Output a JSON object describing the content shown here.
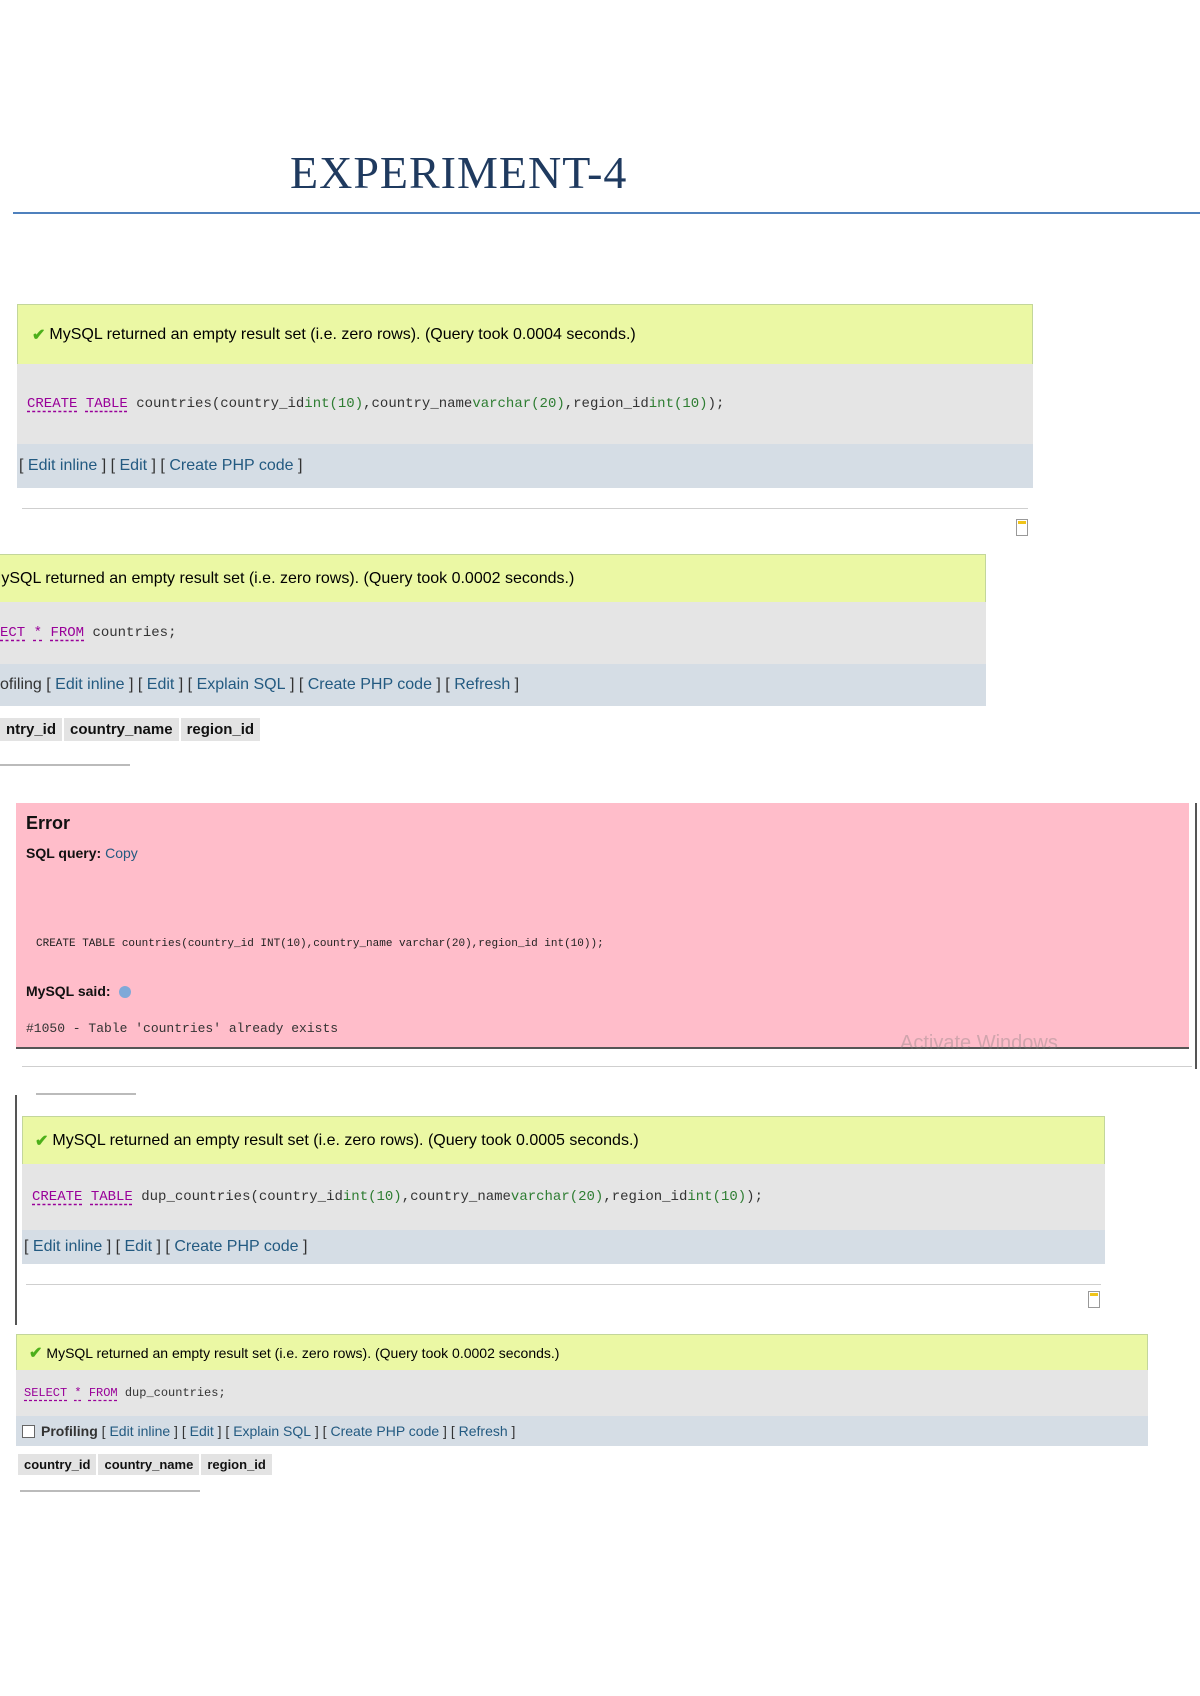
{
  "title": "EXPERIMENT-4",
  "shot1": {
    "message": "MySQL returned an empty result set (i.e. zero rows). (Query took 0.0004 seconds.)",
    "sql": {
      "kw1": "CREATE",
      "kw2": "TABLE",
      "table": "countries",
      "p1": "(country_id ",
      "t1": "int(10)",
      "p2": ",country_name ",
      "t2": "varchar(20)",
      "p3": ",region_id ",
      "t3": "int(10)",
      "p4": ");"
    },
    "actions": [
      "Edit inline",
      "Edit",
      "Create PHP code"
    ]
  },
  "shot2": {
    "message": "MySQL returned an empty result set (i.e. zero rows). (Query took 0.0002 seconds.)",
    "sql": {
      "kw1": "ECT",
      "star": "*",
      "kw2": "FROM",
      "table": "countries;"
    },
    "profiling": "ofiling",
    "actions": [
      "Edit inline",
      "Edit",
      "Explain SQL",
      "Create PHP code",
      "Refresh"
    ],
    "columns": [
      "ntry_id",
      "country_name",
      "region_id"
    ]
  },
  "error": {
    "title": "Error",
    "query_label": "SQL query:",
    "copy": "Copy",
    "sql": "CREATE TABLE countries(country_id INT(10),country_name varchar(20),region_id int(10));",
    "said": "MySQL said:",
    "code": "#1050 - Table 'countries' already exists",
    "watermark": "Activate Windows"
  },
  "shot3": {
    "message": "MySQL returned an empty result set (i.e. zero rows). (Query took 0.0005 seconds.)",
    "sql": {
      "kw1": "CREATE",
      "kw2": "TABLE",
      "table": "dup_countries",
      "p1": "(country_id ",
      "t1": "int(10)",
      "p2": ",country_name ",
      "t2": "varchar(20)",
      "p3": ",region_id ",
      "t3": "int(10)",
      "p4": ");"
    },
    "actions": [
      "Edit inline",
      "Edit",
      "Create PHP code"
    ]
  },
  "shot4": {
    "message": "MySQL returned an empty result set (i.e. zero rows). (Query took 0.0002 seconds.)",
    "sql": {
      "kw1": "SELECT",
      "star": "*",
      "kw2": "FROM",
      "table": "dup_countries;"
    },
    "profiling": "Profiling",
    "actions": [
      "Edit inline",
      "Edit",
      "Explain SQL",
      "Create PHP code",
      "Refresh"
    ],
    "columns": [
      "country_id",
      "country_name",
      "region_id"
    ]
  },
  "colors": {
    "success": "#ebf8a4",
    "sql_bg": "#e5e5e5",
    "action_bg": "#d5dde5",
    "error_bg": "#ffbdca",
    "link": "#235a81",
    "title": "#1f3a5f",
    "rule": "#4f81bd"
  }
}
